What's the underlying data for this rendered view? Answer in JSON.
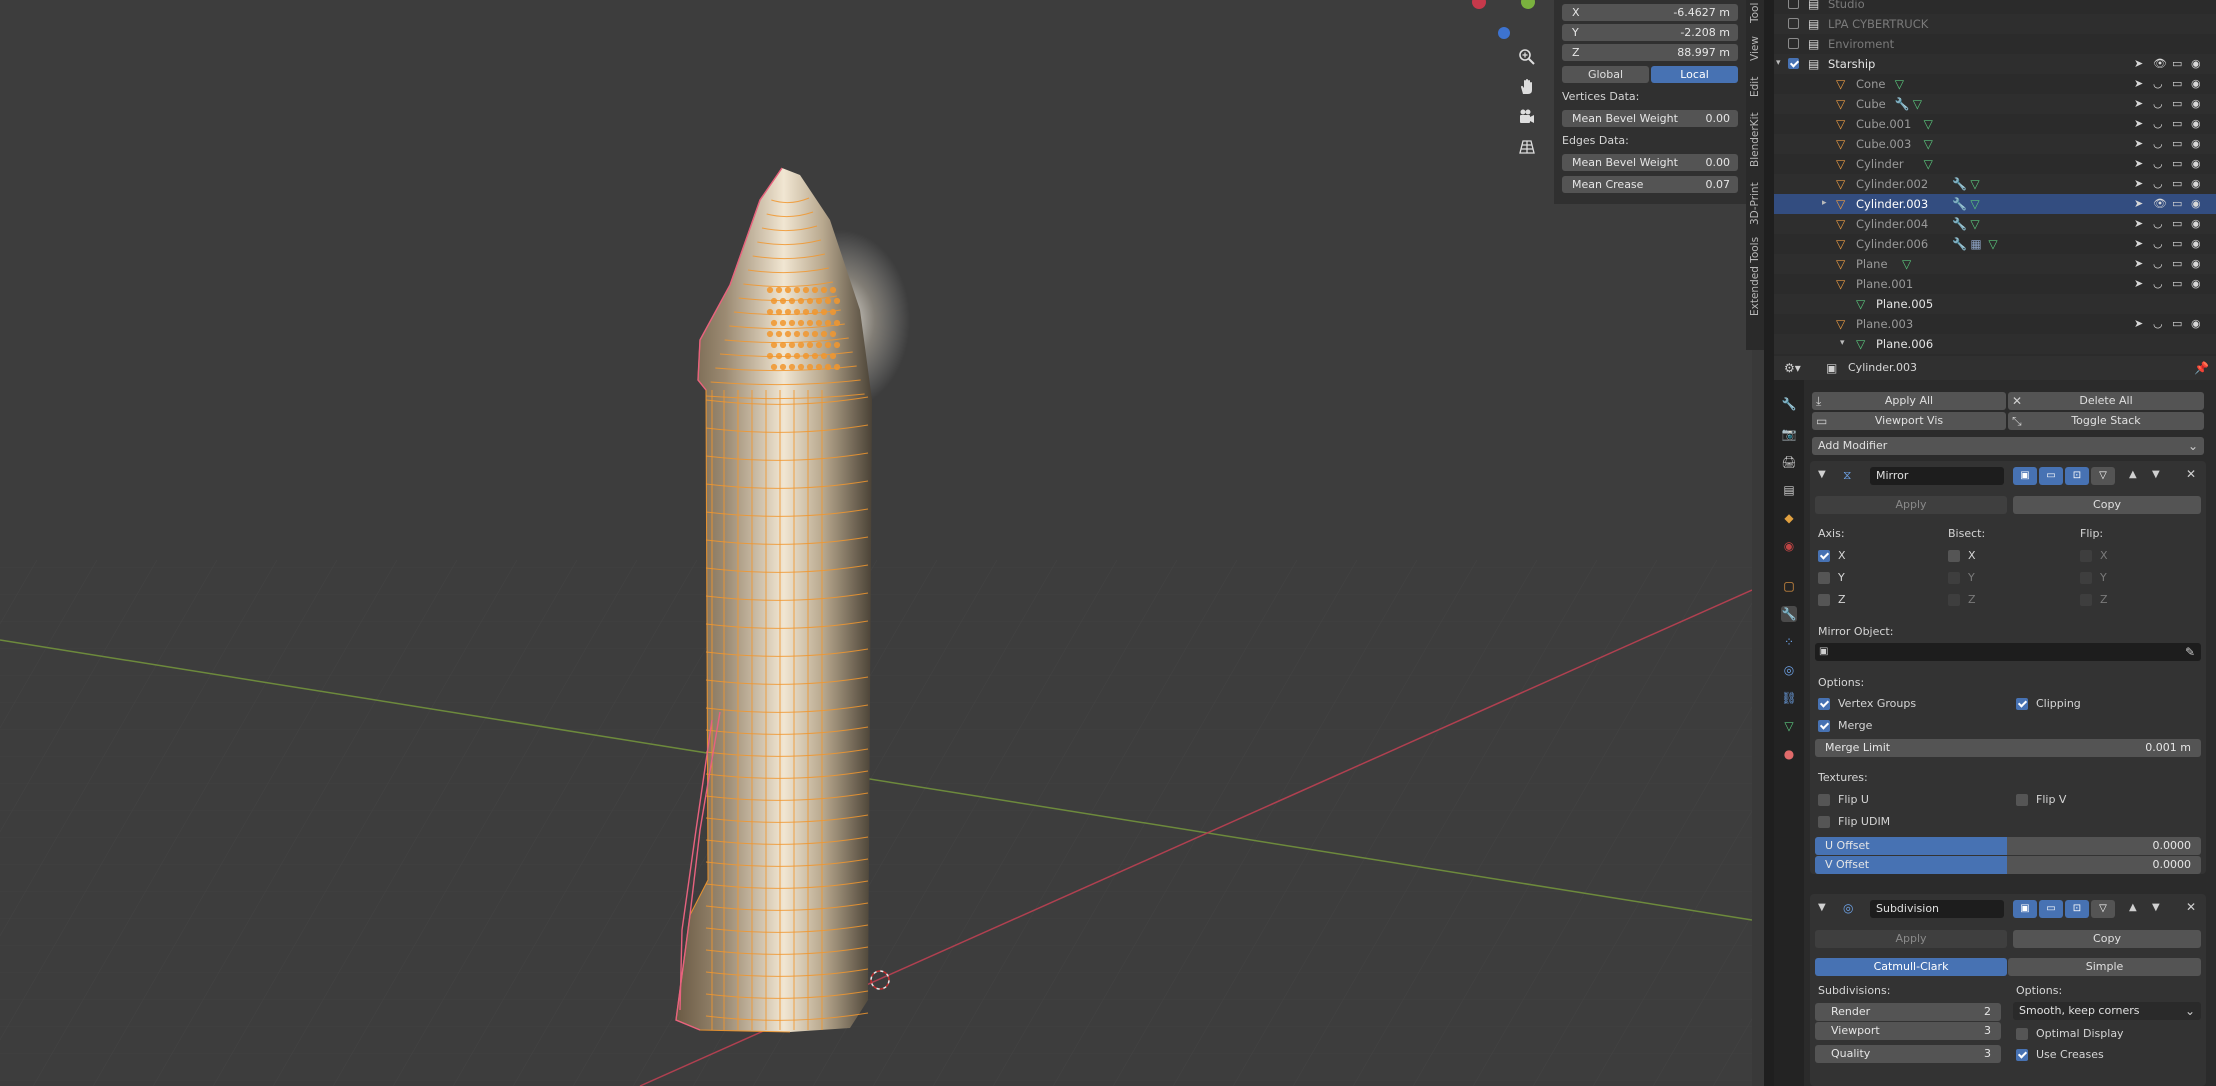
{
  "npanel": {
    "x_label": "X",
    "x_value": "-6.4627 m",
    "y_label": "Y",
    "y_value": "-2.208 m",
    "z_label": "Z",
    "z_value": "88.997 m",
    "global_label": "Global",
    "local_label": "Local",
    "vertices_data": "Vertices Data:",
    "v_bevel_label": "Mean Bevel Weight",
    "v_bevel_value": "0.00",
    "edges_data": "Edges Data:",
    "e_bevel_label": "Mean Bevel Weight",
    "e_bevel_value": "0.00",
    "crease_label": "Mean Crease",
    "crease_value": "0.07"
  },
  "sidebar_tabs": [
    "Tool",
    "View",
    "Edit",
    "BlenderKit",
    "3D-Print",
    "Extended Tools"
  ],
  "outliner": {
    "rows": [
      {
        "label": "Studio",
        "dim": true
      },
      {
        "label": "LPA CYBERTRUCK",
        "dim": true
      },
      {
        "label": "Enviroment",
        "dim": true
      },
      {
        "label": "Starship"
      },
      {
        "label": "Cone"
      },
      {
        "label": "Cube"
      },
      {
        "label": "Cube.001"
      },
      {
        "label": "Cube.003"
      },
      {
        "label": "Cylinder"
      },
      {
        "label": "Cylinder.002"
      },
      {
        "label": "Cylinder.003"
      },
      {
        "label": "Cylinder.004"
      },
      {
        "label": "Cylinder.006"
      },
      {
        "label": "Plane"
      },
      {
        "label": "Plane.001"
      },
      {
        "label": "Plane.005"
      },
      {
        "label": "Plane.003"
      },
      {
        "label": "Plane.006"
      }
    ]
  },
  "properties": {
    "object_name": "Cylinder.003",
    "apply_all": "Apply All",
    "delete_all": "Delete All",
    "viewport_vis": "Viewport Vis",
    "toggle_stack": "Toggle Stack",
    "add_modifier": "Add Modifier",
    "mirror": {
      "name": "Mirror",
      "apply": "Apply",
      "copy": "Copy",
      "axis_label": "Axis:",
      "bisect_label": "Bisect:",
      "flip_label": "Flip:",
      "x": "X",
      "y": "Y",
      "z": "Z",
      "mirror_object_label": "Mirror Object:",
      "options_label": "Options:",
      "vertex_groups": "Vertex Groups",
      "clipping": "Clipping",
      "merge": "Merge",
      "merge_limit_label": "Merge Limit",
      "merge_limit_value": "0.001 m",
      "textures_label": "Textures:",
      "flip_u": "Flip U",
      "flip_v": "Flip V",
      "flip_udim": "Flip UDIM",
      "u_offset_label": "U Offset",
      "u_offset_value": "0.0000",
      "v_offset_label": "V Offset",
      "v_offset_value": "0.0000"
    },
    "subdivision": {
      "name": "Subdivision",
      "apply": "Apply",
      "copy": "Copy",
      "catmull": "Catmull-Clark",
      "simple": "Simple",
      "subdivisions_label": "Subdivisions:",
      "render_label": "Render",
      "render_value": "2",
      "viewport_label": "Viewport",
      "viewport_value": "3",
      "quality_label": "Quality",
      "quality_value": "3",
      "options_label": "Options:",
      "uv_smooth": "Smooth, keep corners",
      "optimal_display": "Optimal Display",
      "use_creases": "Use Creases"
    }
  },
  "colors": {
    "accent": "#4772b3",
    "selection_orange": "#f2972e",
    "outline_pink": "#e8627f",
    "x_axis": "#b04050",
    "y_axis": "#6d8a3c"
  }
}
